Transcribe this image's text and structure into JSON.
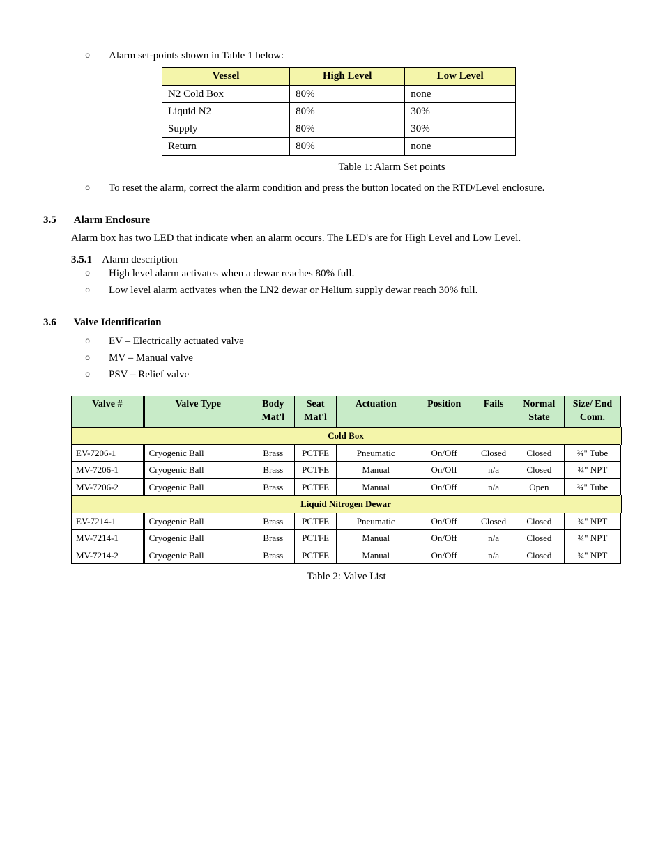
{
  "setpoints": {
    "intro": "Alarm set-points shown in Table 1 below:",
    "table_label": "Table 1:  Alarm Set points",
    "headers": [
      "Vessel",
      "High Level",
      "Low Level"
    ],
    "rows": [
      {
        "vessel": "N2 Cold Box",
        "high": "80%",
        "low": "none"
      },
      {
        "vessel": "Liquid N2",
        "high": "80%",
        "low": "30%"
      },
      {
        "vessel": "Supply",
        "high": "80%",
        "low": "30%"
      },
      {
        "vessel": "Return",
        "high": "80%",
        "low": "none"
      }
    ],
    "reset_text": "To reset the alarm, correct the alarm condition and press the button located on the RTD/Level enclosure."
  },
  "sections": {
    "sec_3_5": {
      "num": "3.5",
      "title": "Alarm Enclosure",
      "body": "Alarm box has two LED that indicate when an alarm occurs.  The LED's are for High Level and Low Level.",
      "sub": {
        "num": "3.5.1",
        "title": "Alarm description",
        "items": [
          "High level alarm activates when a dewar reaches 80% full.",
          "Low level alarm activates when the LN2 dewar or Helium supply dewar reach 30% full."
        ]
      }
    },
    "sec_3_6": {
      "num": "3.6",
      "title": "Valve Identification",
      "items": [
        {
          "pre": "EV",
          "post": " – Electrically actuated valve"
        },
        {
          "pre": "MV",
          "post": "   – Manual valve"
        },
        {
          "pre": "PSV",
          "post": "   – Relief valve"
        }
      ]
    }
  },
  "valves": {
    "caption": "Table 2:  Valve List",
    "headers": [
      "Valve #",
      "Valve Type",
      "Body Mat'l",
      "Seat Mat'l",
      "Actuation",
      "Position",
      "Fails",
      "Normal State",
      "Size/ End Conn."
    ],
    "groups": [
      {
        "name": "Cold Box",
        "rows": [
          {
            "num": "EV-7206-1",
            "type": "Cryogenic Ball",
            "body": "Brass",
            "seat": "PCTFE",
            "act": "Pneumatic",
            "pos": "On/Off",
            "fails": "Closed",
            "state": "Closed",
            "size": "¾\" Tube"
          },
          {
            "num": "MV-7206-1",
            "type": "Cryogenic Ball",
            "body": "Brass",
            "seat": "PCTFE",
            "act": "Manual",
            "pos": "On/Off",
            "fails": "n/a",
            "state": "Closed",
            "size": "¾\" NPT"
          },
          {
            "num": "MV-7206-2",
            "type": "Cryogenic Ball",
            "body": "Brass",
            "seat": "PCTFE",
            "act": "Manual",
            "pos": "On/Off",
            "fails": "n/a",
            "state": "Open",
            "size": "¾\" Tube"
          }
        ]
      },
      {
        "name": "Liquid Nitrogen Dewar",
        "rows": [
          {
            "num": "EV-7214-1",
            "type": "Cryogenic Ball",
            "body": "Brass",
            "seat": "PCTFE",
            "act": "Pneumatic",
            "pos": "On/Off",
            "fails": "Closed",
            "state": "Closed",
            "size": "¾\" NPT"
          },
          {
            "num": "MV-7214-1",
            "type": "Cryogenic Ball",
            "body": "Brass",
            "seat": "PCTFE",
            "act": "Manual",
            "pos": "On/Off",
            "fails": "n/a",
            "state": "Closed",
            "size": "¾\" NPT"
          },
          {
            "num": "MV-7214-2",
            "type": "Cryogenic Ball",
            "body": "Brass",
            "seat": "PCTFE",
            "act": "Manual",
            "pos": "On/Off",
            "fails": "n/a",
            "state": "Closed",
            "size": "¾\" NPT"
          }
        ]
      }
    ]
  }
}
